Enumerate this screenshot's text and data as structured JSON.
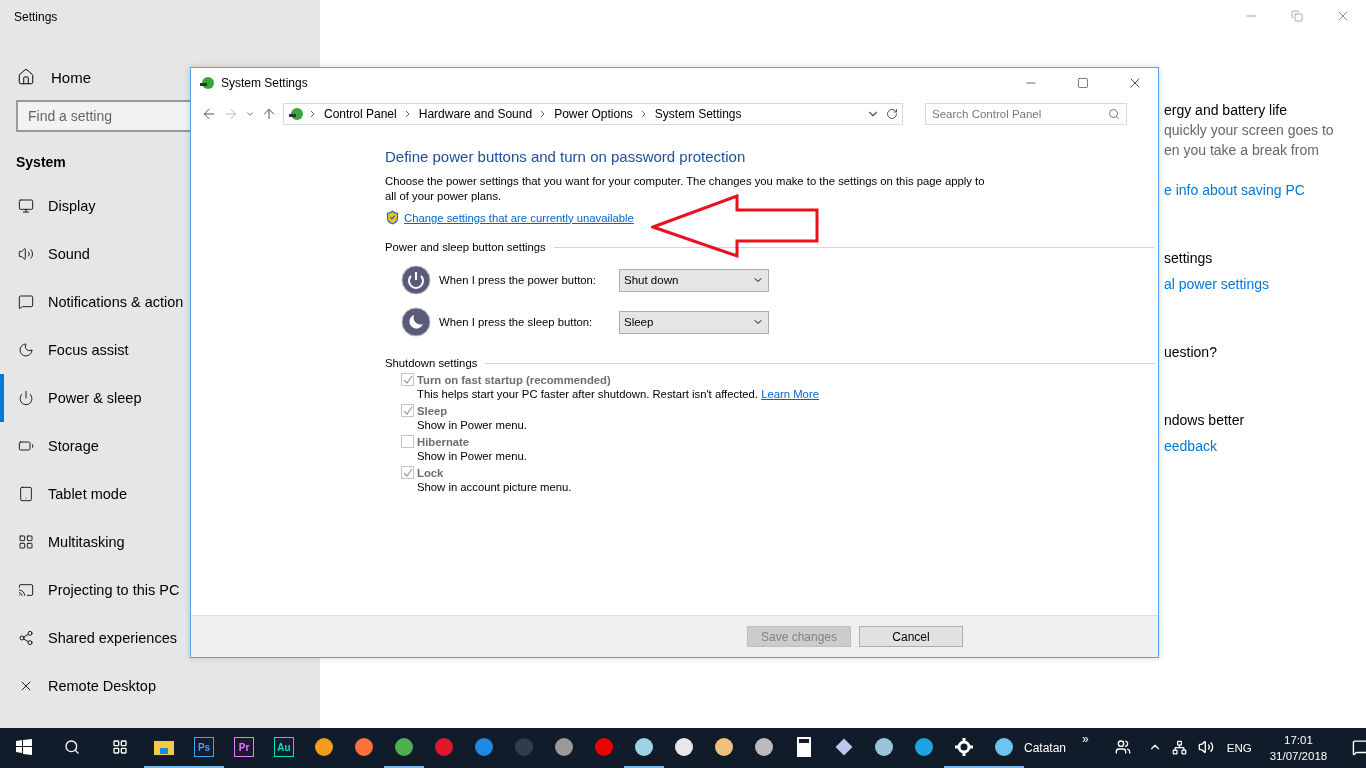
{
  "settings_window": {
    "title": "Settings",
    "home": "Home",
    "search": {
      "placeholder": "Find a setting"
    },
    "section": "System",
    "nav": [
      {
        "label": "Display",
        "selected": false
      },
      {
        "label": "Sound",
        "selected": false
      },
      {
        "label": "Notifications & action",
        "selected": false
      },
      {
        "label": "Focus assist",
        "selected": false
      },
      {
        "label": "Power & sleep",
        "selected": true
      },
      {
        "label": "Storage",
        "selected": false
      },
      {
        "label": "Tablet mode",
        "selected": false
      },
      {
        "label": "Multitasking",
        "selected": false
      },
      {
        "label": "Projecting to this PC",
        "selected": false
      },
      {
        "label": "Shared experiences",
        "selected": false
      },
      {
        "label": "Remote Desktop",
        "selected": false
      }
    ],
    "content": [
      {
        "kind": "heading",
        "text": "ergy and battery life"
      },
      {
        "kind": "body",
        "text": "quickly your screen goes to"
      },
      {
        "kind": "body",
        "text": "en you take a break from"
      },
      {
        "kind": "link",
        "text": "e info about saving PC"
      },
      {
        "kind": "heading",
        "text": "settings"
      },
      {
        "kind": "link",
        "text": "al power settings"
      },
      {
        "kind": "heading",
        "text": "uestion?"
      },
      {
        "kind": "heading",
        "text": "ndows better"
      },
      {
        "kind": "link",
        "text": "eedback"
      }
    ]
  },
  "dialog": {
    "title": "System Settings",
    "breadcrumbs": [
      "Control Panel",
      "Hardware and Sound",
      "Power Options",
      "System Settings"
    ],
    "search": {
      "placeholder": "Search Control Panel"
    },
    "heading": "Define power buttons and turn on password protection",
    "intro": "Choose the power settings that you want for your computer. The changes you make to the settings on this page apply to all of your power plans.",
    "admin_link": "Change settings that are currently unavailable",
    "button_group": {
      "title": "Power and sleep button settings",
      "rows": [
        {
          "label": "When I press the power button:",
          "value": "Shut down"
        },
        {
          "label": "When I press the sleep button:",
          "value": "Sleep"
        }
      ]
    },
    "shutdown_group": {
      "title": "Shutdown settings",
      "options": [
        {
          "label": "Turn on fast startup (recommended)",
          "description": "This helps start your PC faster after shutdown. Restart isn't affected.",
          "link": "Learn More",
          "checked": true,
          "disabled": true
        },
        {
          "label": "Sleep",
          "description": "Show in Power menu.",
          "checked": true,
          "disabled": true
        },
        {
          "label": "Hibernate",
          "description": "Show in Power menu.",
          "checked": false,
          "disabled": true
        },
        {
          "label": "Lock",
          "description": "Show in account picture menu.",
          "checked": true,
          "disabled": true
        }
      ]
    },
    "buttons": [
      {
        "label": "Save changes",
        "disabled": true
      },
      {
        "label": "Cancel",
        "disabled": false
      }
    ]
  },
  "taskbar": {
    "apps": [
      {
        "kind": "icon",
        "running": true
      },
      {
        "kind": "tile",
        "label": "Ps",
        "color": "#31a8ff",
        "running": true
      },
      {
        "kind": "tile",
        "label": "Pr",
        "color": "#ea77ff",
        "running": false
      },
      {
        "kind": "tile",
        "label": "Au",
        "color": "#00e4bb",
        "running": false
      },
      {
        "kind": "icon",
        "running": false
      },
      {
        "kind": "icon",
        "running": false
      },
      {
        "kind": "icon",
        "running": true
      },
      {
        "kind": "icon",
        "running": false
      },
      {
        "kind": "icon",
        "running": false
      },
      {
        "kind": "icon",
        "running": false
      },
      {
        "kind": "icon",
        "running": false
      },
      {
        "kind": "icon",
        "running": false
      },
      {
        "kind": "icon",
        "running": true
      },
      {
        "kind": "icon",
        "running": false
      },
      {
        "kind": "icon",
        "running": false
      },
      {
        "kind": "icon",
        "running": false
      },
      {
        "kind": "icon",
        "running": false
      },
      {
        "kind": "icon",
        "running": false
      },
      {
        "kind": "icon",
        "running": false
      },
      {
        "kind": "icon",
        "running": false
      },
      {
        "kind": "icon",
        "running": true
      },
      {
        "kind": "icon",
        "running": true
      }
    ],
    "toolbar_label": "Catatan",
    "toolbar_more": "»",
    "language": "ENG",
    "time": "17:01",
    "date": "31/07/2018"
  }
}
